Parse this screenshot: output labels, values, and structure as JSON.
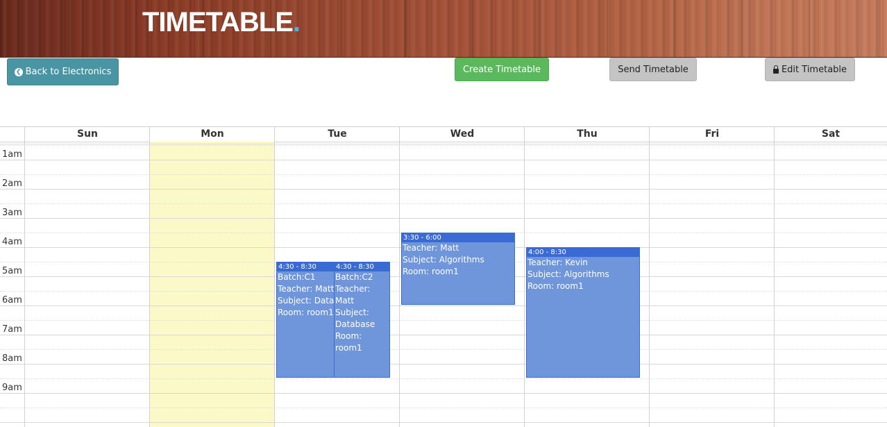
{
  "header": {
    "title": "TIMETABLE",
    "title_dot": "."
  },
  "toolbar": {
    "back_label": "Back to Electronics",
    "create_label": "Create Timetable",
    "send_label": "Send Timetable",
    "edit_label": "Edit Timetable"
  },
  "calendar": {
    "days": [
      "Sun",
      "Mon",
      "Tue",
      "Wed",
      "Thu",
      "Fri",
      "Sat"
    ],
    "today": "Mon",
    "time_labels": [
      "1am",
      "2am",
      "3am",
      "4am",
      "5am",
      "6am",
      "7am",
      "8am",
      "9am"
    ],
    "events": [
      {
        "time": "4:30 - 8:30",
        "lines": [
          "Batch:C1",
          "Teacher: Matt",
          "Subject: Database",
          "Room: room1"
        ]
      },
      {
        "time": "4:30 - 8:30",
        "lines": [
          "Batch:C2",
          "Teacher: Matt",
          "Subject: Database",
          "Room: room1"
        ]
      },
      {
        "time": "3:30 - 6:00",
        "lines": [
          "Teacher: Matt",
          "Subject: Algorithms",
          "Room: room1"
        ]
      },
      {
        "time": "4:00 - 8:30",
        "lines": [
          "Teacher: Kevin",
          "Subject: Algorithms",
          "Room: room1"
        ]
      }
    ]
  },
  "colors": {
    "back_button": "#4a95a3",
    "create_button": "#5cb85c",
    "gray_button": "#c4c4c4",
    "event_fill": "#6f95db",
    "event_header": "#3a6bd4",
    "today_highlight": "#fcf9c9",
    "title_dot": "#48b4e6"
  }
}
